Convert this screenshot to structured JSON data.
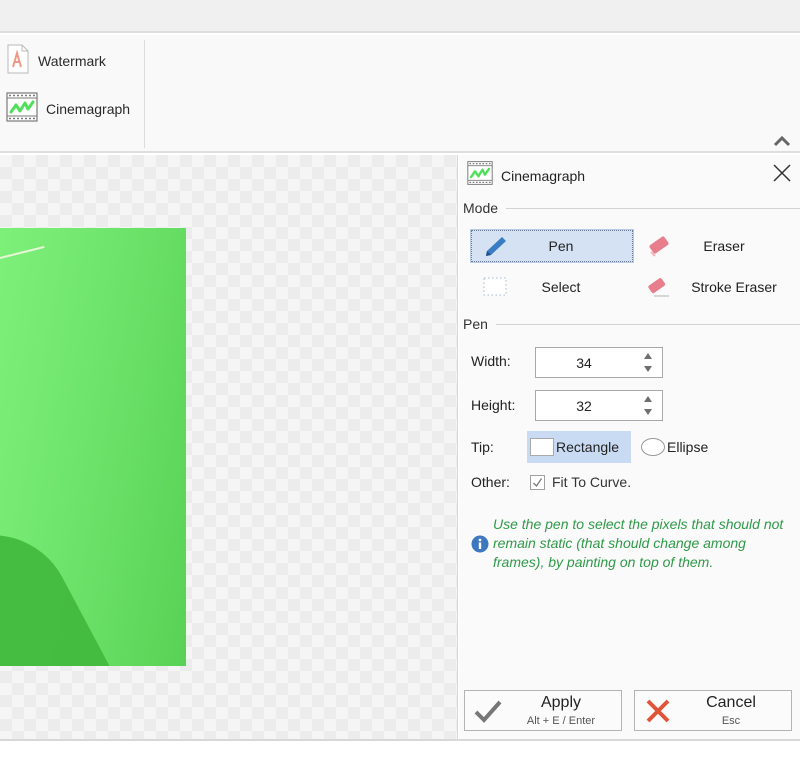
{
  "ribbon": {
    "items": [
      {
        "label": "Watermark",
        "icon": "watermark-icon"
      },
      {
        "label": "Cinemagraph",
        "icon": "cinemagraph-icon"
      }
    ],
    "collapse_icon": "chevron-up-icon"
  },
  "panel": {
    "title": "Cinemagraph",
    "close_icon": "close-icon",
    "mode": {
      "label": "Mode",
      "options": [
        {
          "label": "Pen",
          "icon": "pen-icon",
          "selected": true
        },
        {
          "label": "Eraser",
          "icon": "eraser-icon",
          "selected": false
        },
        {
          "label": "Select",
          "icon": "select-rectangle-icon",
          "selected": false
        },
        {
          "label": "Stroke Eraser",
          "icon": "stroke-eraser-icon",
          "selected": false
        }
      ]
    },
    "pen": {
      "label": "Pen",
      "width_label": "Width:",
      "width_value": "34",
      "height_label": "Height:",
      "height_value": "32",
      "tip_label": "Tip:",
      "tip_options": [
        {
          "label": "Rectangle",
          "selected": true
        },
        {
          "label": "Ellipse",
          "selected": false
        }
      ],
      "other_label": "Other:",
      "fit_to_curve_label": "Fit To Curve.",
      "fit_to_curve_checked": true
    },
    "info_text": "Use the pen to select the pixels that should not remain static (that should change among frames), by painting on top of them.",
    "info_color": "#2e9a48"
  },
  "footer": {
    "apply_label": "Apply",
    "apply_shortcut": "Alt + E / Enter",
    "cancel_label": "Cancel",
    "cancel_shortcut": "Esc"
  }
}
